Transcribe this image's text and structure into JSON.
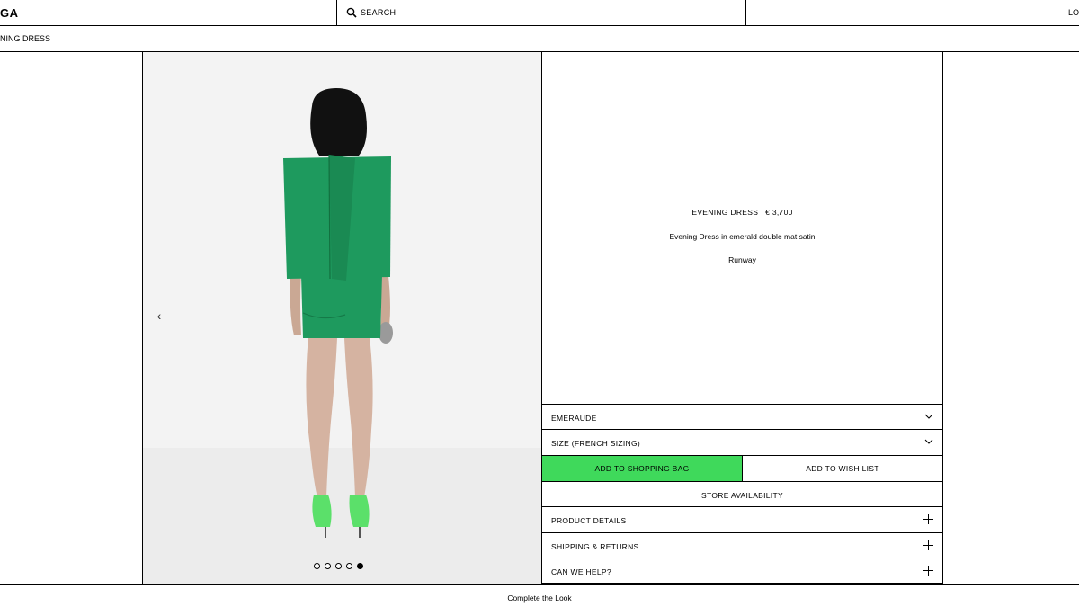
{
  "header": {
    "logo": "GA",
    "search_label": "SEARCH",
    "login_label": "LO"
  },
  "breadcrumb": {
    "current": "NING DRESS"
  },
  "gallery": {
    "prev_arrow": "‹",
    "slide_count": 5,
    "active_slide": 5
  },
  "product": {
    "name": "EVENING DRESS",
    "price": "€ 3,700",
    "description": "Evening Dress in emerald double mat satin",
    "category": "Runway"
  },
  "options": {
    "color_label": "EMERAUDE",
    "size_label": "SIZE (FRENCH SIZING)"
  },
  "actions": {
    "add_to_bag": "ADD TO SHOPPING BAG",
    "add_to_wishlist": "ADD TO WISH LIST",
    "store_availability": "STORE AVAILABILITY"
  },
  "accordion": {
    "product_details": "PRODUCT DETAILS",
    "shipping_returns": "SHIPPING & RETURNS",
    "help": "CAN WE HELP?"
  },
  "footer": {
    "complete_the_look": "Complete the Look"
  },
  "colors": {
    "add_button": "#3fd95b",
    "dress": "#1e9a5e",
    "shoes": "#5be06a"
  }
}
